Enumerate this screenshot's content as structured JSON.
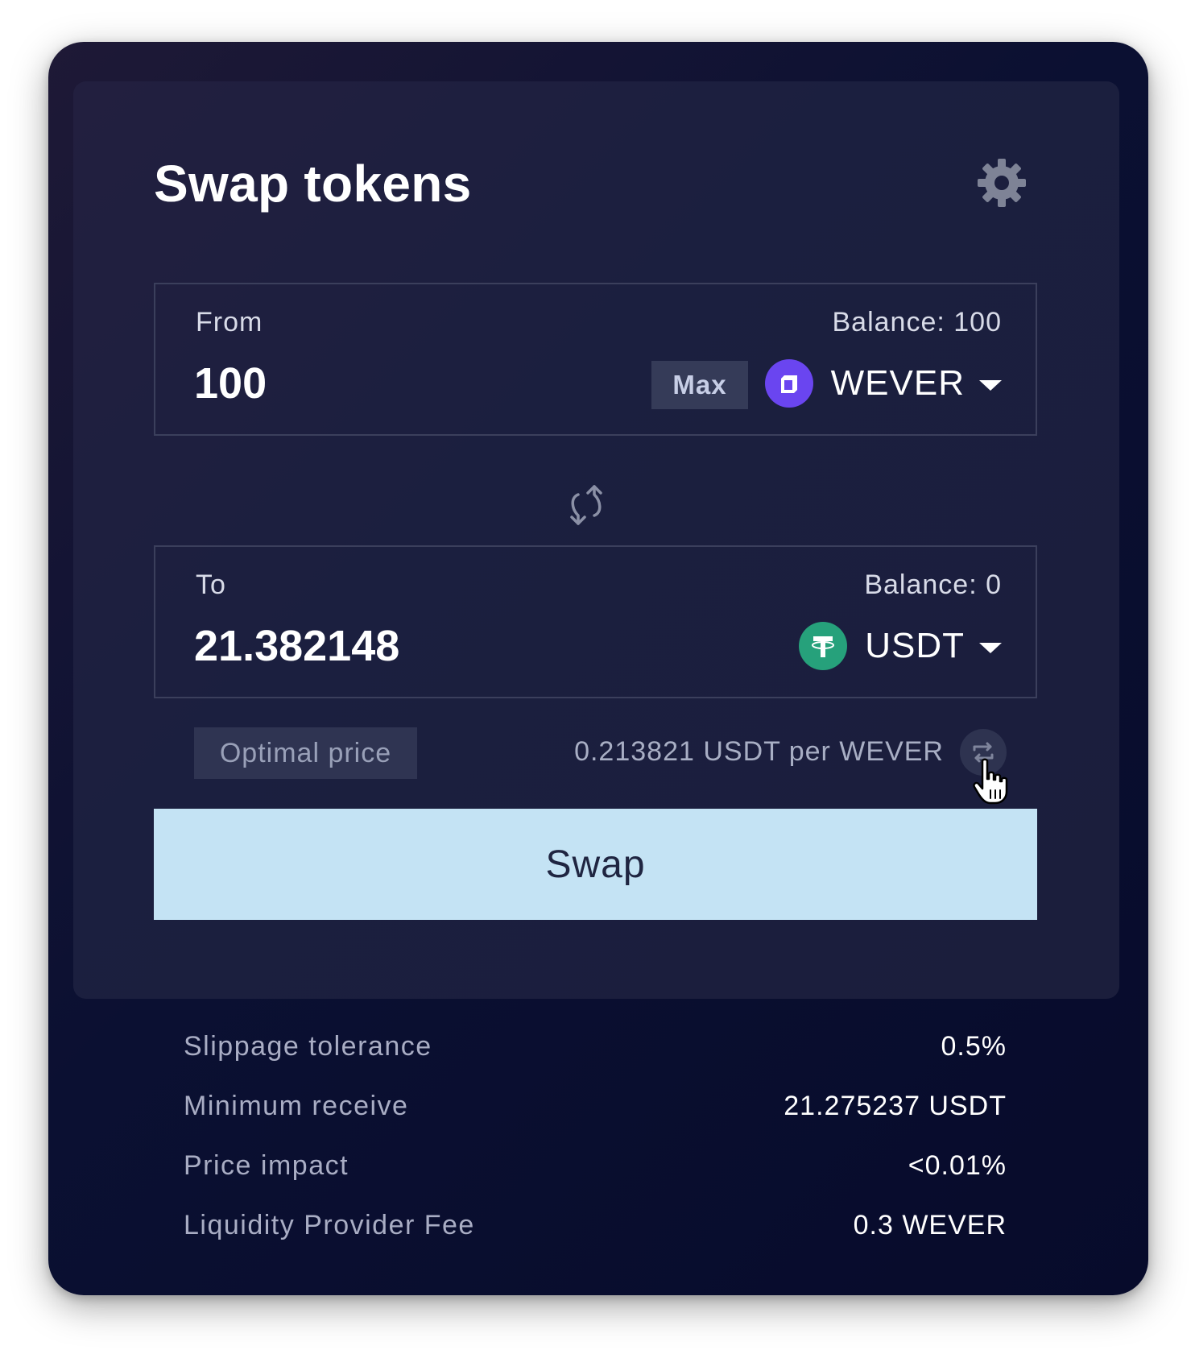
{
  "title": "Swap tokens",
  "from": {
    "label": "From",
    "balance": "Balance: 100",
    "amount": "100",
    "max_label": "Max",
    "token": "WEVER"
  },
  "to": {
    "label": "To",
    "balance": "Balance: 0",
    "amount": "21.382148",
    "token": "USDT"
  },
  "price": {
    "badge": "Optimal price",
    "rate": "0.213821 USDT per WEVER"
  },
  "swap_label": "Swap",
  "details": [
    {
      "label": "Slippage tolerance",
      "value": "0.5%"
    },
    {
      "label": "Minimum receive",
      "value": "21.275237 USDT"
    },
    {
      "label": "Price impact",
      "value": "<0.01%"
    },
    {
      "label": "Liquidity Provider Fee",
      "value": "0.3 WEVER"
    }
  ],
  "colors": {
    "swap_button": "#c4e3f4",
    "wever_brand": "#6a45f0",
    "usdt_brand": "#26a17b"
  },
  "icons": {
    "settings": "gear-icon",
    "swap_direction": "swap-vertical-icon",
    "rate_toggle": "swap-horizontal-icon",
    "cursor": "hand-pointer-icon"
  }
}
